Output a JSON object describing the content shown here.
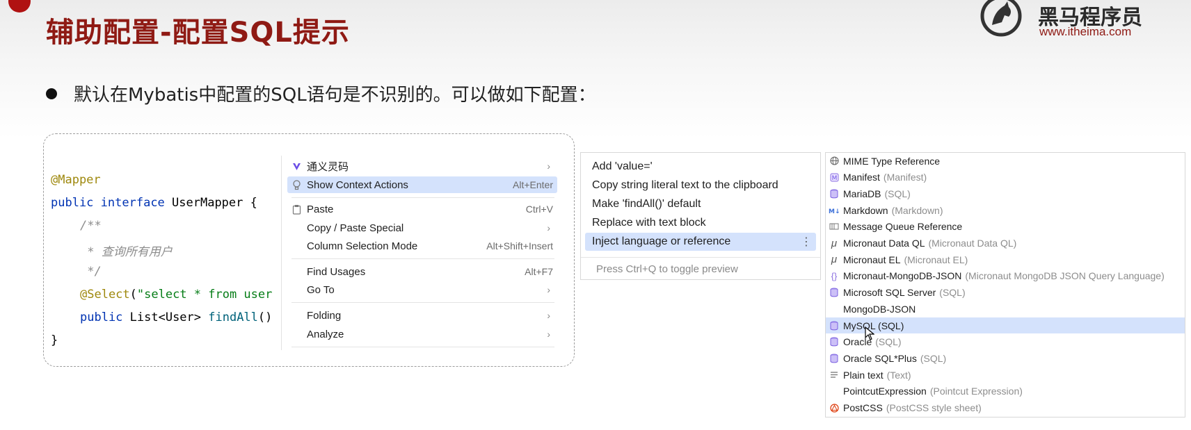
{
  "slide": {
    "title": "辅助配置-配置SQL提示",
    "bullet": "默认在Mybatis中配置的SQL语句是不识别的。可以做如下配置：",
    "logo_cn": "黑马程序员",
    "logo_url": "www.itheima.com",
    "brand_color": "#8f1a14"
  },
  "code": {
    "line1": "@Mapper",
    "line2_kw1": "public",
    "line2_kw2": "interface",
    "line2_rest": " UserMapper {",
    "line3": "/**",
    "line4": " * 查询所有用户",
    "line5": " */",
    "line6_ann": "@Select",
    "line6_p1": "(",
    "line6_str": "\"select * from user",
    "line7_kw": "public",
    "line7_type": " List<User> ",
    "line7_fn": "findAll",
    "line7_rest": "()",
    "line8": "}"
  },
  "context_menu": {
    "items": [
      {
        "label": "通义灵码",
        "shortcut": "",
        "submenu": true,
        "icon": "tongyi-icon"
      },
      {
        "label": "Show Context Actions",
        "shortcut": "Alt+Enter",
        "submenu": false,
        "icon": "bulb-icon",
        "selected": true
      },
      {
        "label": "Paste",
        "shortcut": "Ctrl+V",
        "submenu": false,
        "icon": "clipboard-icon"
      },
      {
        "label": "Copy / Paste Special",
        "shortcut": "",
        "submenu": true
      },
      {
        "label": "Column Selection Mode",
        "shortcut": "Alt+Shift+Insert",
        "submenu": false
      },
      {
        "label": "Find Usages",
        "shortcut": "Alt+F7",
        "submenu": false
      },
      {
        "label": "Go To",
        "shortcut": "",
        "submenu": true
      },
      {
        "label": "Folding",
        "shortcut": "",
        "submenu": true
      },
      {
        "label": "Analyze",
        "shortcut": "",
        "submenu": true
      }
    ]
  },
  "actions_menu": {
    "items": [
      {
        "label": "Add 'value='"
      },
      {
        "label": "Copy string literal text to the clipboard"
      },
      {
        "label": "Make 'findAll()' default"
      },
      {
        "label": "Replace with text block"
      },
      {
        "label": "Inject language or reference",
        "selected": true
      }
    ],
    "footer": "Press Ctrl+Q to toggle preview"
  },
  "language_menu": {
    "items": [
      {
        "name": "MIME Type Reference",
        "desc": "",
        "icon": "globe-icon"
      },
      {
        "name": "Manifest",
        "desc": "(Manifest)",
        "icon": "manifest-icon"
      },
      {
        "name": "MariaDB",
        "desc": "(SQL)",
        "icon": "database-icon"
      },
      {
        "name": "Markdown",
        "desc": "(Markdown)",
        "icon": "markdown-icon"
      },
      {
        "name": "Message Queue Reference",
        "desc": "",
        "icon": "queue-icon"
      },
      {
        "name": "Micronaut Data QL",
        "desc": "(Micronaut Data QL)",
        "icon": "micronaut-icon"
      },
      {
        "name": "Micronaut EL",
        "desc": "(Micronaut EL)",
        "icon": "micronaut-icon"
      },
      {
        "name": "Micronaut-MongoDB-JSON",
        "desc": "(Micronaut MongoDB JSON Query Language)",
        "icon": "json-icon"
      },
      {
        "name": "Microsoft SQL Server",
        "desc": "(SQL)",
        "icon": "database-icon"
      },
      {
        "name": "MongoDB-JSON",
        "desc": "",
        "icon": ""
      },
      {
        "name": "MySQL (SQL)",
        "desc": "",
        "icon": "database-icon",
        "selected": true
      },
      {
        "name": "Oracle",
        "desc": "(SQL)",
        "icon": "database-icon"
      },
      {
        "name": "Oracle SQL*Plus",
        "desc": "(SQL)",
        "icon": "database-icon"
      },
      {
        "name": "Plain text",
        "desc": "(Text)",
        "icon": "text-lines-icon"
      },
      {
        "name": "PointcutExpression",
        "desc": "(Pointcut Expression)",
        "icon": ""
      },
      {
        "name": "PostCSS",
        "desc": "(PostCSS style sheet)",
        "icon": "postcss-icon"
      }
    ]
  }
}
